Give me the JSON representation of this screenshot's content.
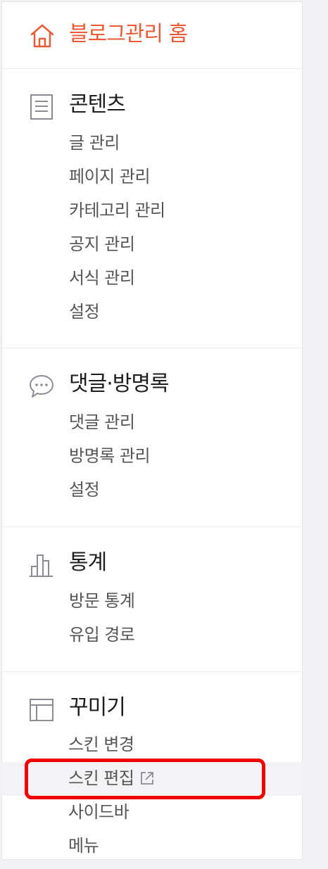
{
  "home": {
    "label": "블로그관리 홈",
    "icon": "home-icon",
    "color": "#ea5a36"
  },
  "sections": [
    {
      "title": "콘텐츠",
      "icon": "document-icon",
      "items": [
        "글 관리",
        "페이지 관리",
        "카테고리 관리",
        "공지 관리",
        "서식 관리",
        "설정"
      ]
    },
    {
      "title": "댓글·방명록",
      "icon": "speech-bubble-icon",
      "items": [
        "댓글 관리",
        "방명록 관리",
        "설정"
      ]
    },
    {
      "title": "통계",
      "icon": "bar-chart-icon",
      "items": [
        "방문 통계",
        "유입 경로"
      ]
    },
    {
      "title": "꾸미기",
      "icon": "layout-icon",
      "items": [
        "스킨 변경",
        "스킨 편집",
        "사이드바",
        "메뉴"
      ],
      "active_item": "스킨 편집",
      "external_link_icon": "external-link-icon"
    }
  ],
  "highlight_color": "#f20000"
}
